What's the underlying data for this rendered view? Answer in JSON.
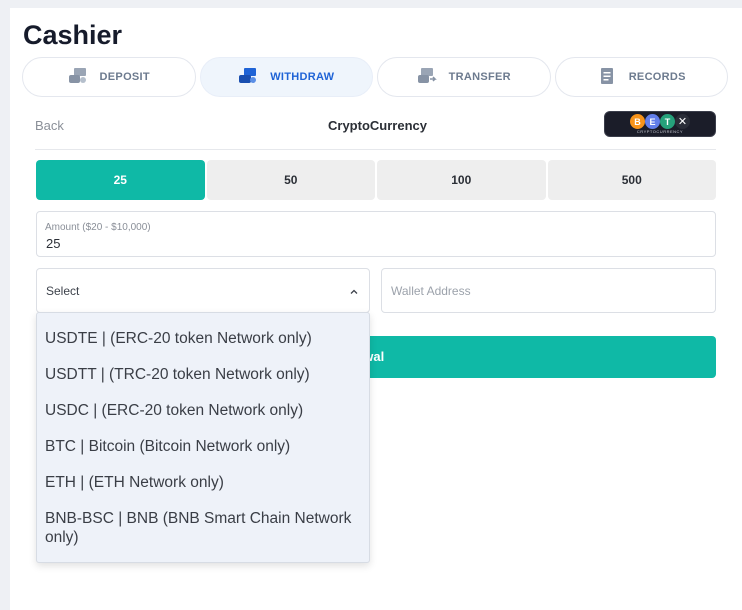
{
  "page": {
    "title": "Cashier"
  },
  "tabs": [
    {
      "label": "DEPOSIT",
      "icon": "deposit-icon",
      "active": false
    },
    {
      "label": "WITHDRAW",
      "icon": "withdraw-icon",
      "active": true
    },
    {
      "label": "TRANSFER",
      "icon": "transfer-icon",
      "active": false
    },
    {
      "label": "RECORDS",
      "icon": "records-icon",
      "active": false
    }
  ],
  "header": {
    "back_label": "Back",
    "method_title": "CryptoCurrency",
    "badge": {
      "coins": [
        {
          "symbol": "B",
          "name": "bitcoin-coin-icon",
          "color": "#f7931a"
        },
        {
          "symbol": "E",
          "name": "ethereum-coin-icon",
          "color": "#627eea"
        },
        {
          "symbol": "T",
          "name": "tether-coin-icon",
          "color": "#26a17b"
        },
        {
          "symbol": "✕",
          "name": "xrp-coin-icon",
          "color": "#2a2d38"
        }
      ],
      "text": "CRYPTOCURRENCY"
    }
  },
  "amount_options": [
    {
      "label": "25",
      "selected": true
    },
    {
      "label": "50",
      "selected": false
    },
    {
      "label": "100",
      "selected": false
    },
    {
      "label": "500",
      "selected": false
    }
  ],
  "amount_field": {
    "label": "Amount ($20 - $10,000)",
    "value": "25"
  },
  "currency_select": {
    "value": "Select",
    "options": [
      "USDTE | (ERC-20 token Network only)",
      "USDTT | (TRC-20 token Network only)",
      "USDC | (ERC-20 token Network only)",
      "BTC | Bitcoin (Bitcoin Network only)",
      "ETH | (ETH Network only)",
      "BNB-BSC | BNB (BNB Smart Chain Network only)"
    ]
  },
  "wallet_field": {
    "placeholder": "Wallet Address",
    "value": ""
  },
  "submit": {
    "visible_label": "drawal"
  },
  "colors": {
    "accent": "#0fb9a6",
    "active_tab_text": "#1f63d6",
    "active_tab_bg": "#eff5fc"
  }
}
